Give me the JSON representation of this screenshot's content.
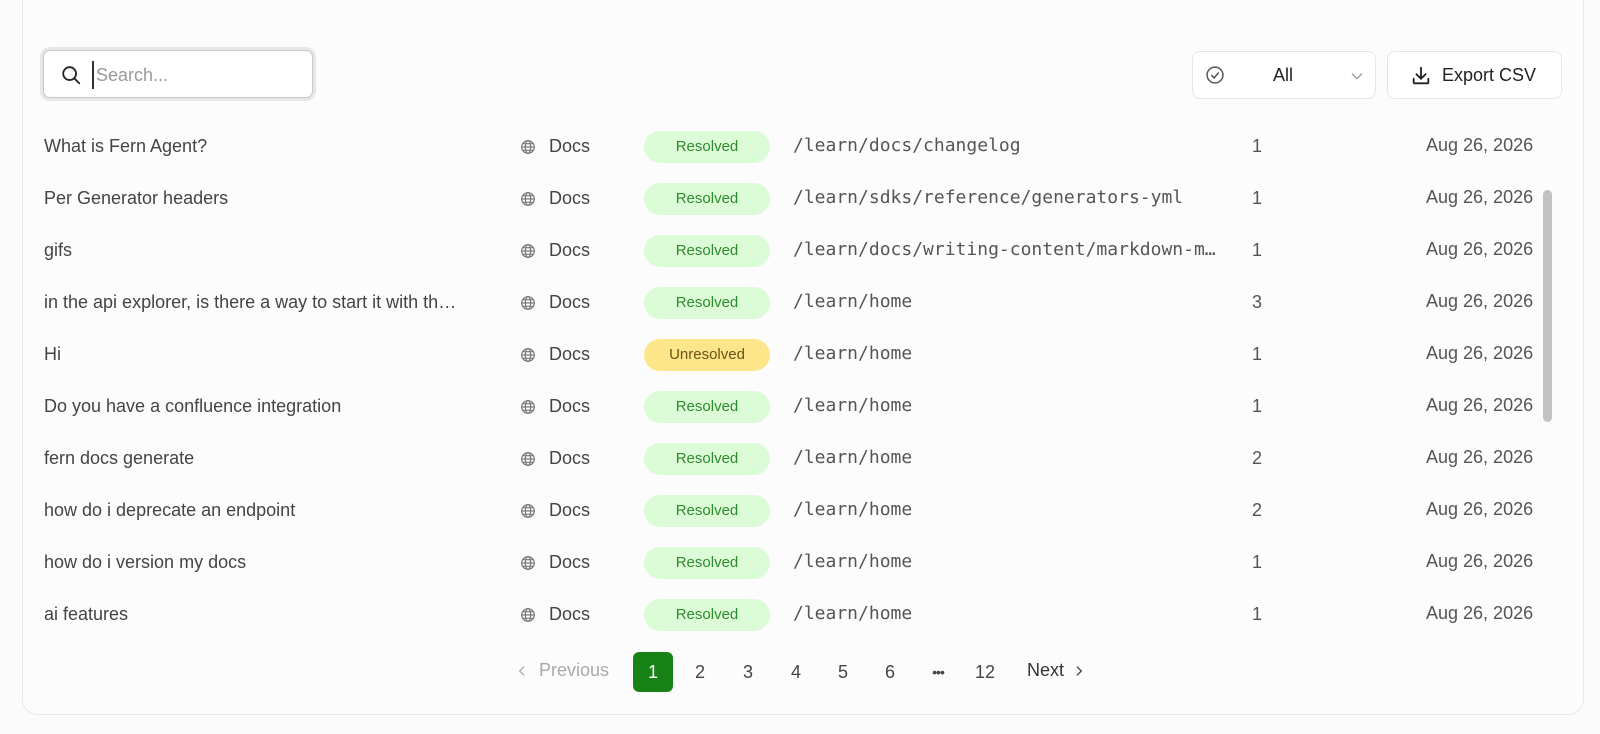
{
  "search": {
    "placeholder": "Search..."
  },
  "filter": {
    "selected": "All"
  },
  "export": {
    "label": "Export CSV"
  },
  "rows": [
    {
      "question": "What is Fern Agent?",
      "source": "Docs",
      "status": "Resolved",
      "path": "/learn/docs/changelog",
      "count": "1",
      "date": "Aug 26, 2026"
    },
    {
      "question": "Per Generator headers",
      "source": "Docs",
      "status": "Resolved",
      "path": "/learn/sdks/reference/generators-yml",
      "count": "1",
      "date": "Aug 26, 2026"
    },
    {
      "question": "gifs",
      "source": "Docs",
      "status": "Resolved",
      "path": "/learn/docs/writing-content/markdown-m…",
      "count": "1",
      "date": "Aug 26, 2026"
    },
    {
      "question": "in the api explorer, is there a way to start it with th…",
      "source": "Docs",
      "status": "Resolved",
      "path": "/learn/home",
      "count": "3",
      "date": "Aug 26, 2026"
    },
    {
      "question": "Hi",
      "source": "Docs",
      "status": "Unresolved",
      "path": "/learn/home",
      "count": "1",
      "date": "Aug 26, 2026"
    },
    {
      "question": "Do you have a confluence integration",
      "source": "Docs",
      "status": "Resolved",
      "path": "/learn/home",
      "count": "1",
      "date": "Aug 26, 2026"
    },
    {
      "question": "fern docs generate",
      "source": "Docs",
      "status": "Resolved",
      "path": "/learn/home",
      "count": "2",
      "date": "Aug 26, 2026"
    },
    {
      "question": "how do i deprecate an endpoint",
      "source": "Docs",
      "status": "Resolved",
      "path": "/learn/home",
      "count": "2",
      "date": "Aug 26, 2026"
    },
    {
      "question": "how do i version my docs",
      "source": "Docs",
      "status": "Resolved",
      "path": "/learn/home",
      "count": "1",
      "date": "Aug 26, 2026"
    },
    {
      "question": "ai features",
      "source": "Docs",
      "status": "Resolved",
      "path": "/learn/home",
      "count": "1",
      "date": "Aug 26, 2026"
    }
  ],
  "pagination": {
    "previous": "Previous",
    "next": "Next",
    "pages": [
      "1",
      "2",
      "3",
      "4",
      "5",
      "6",
      "12"
    ],
    "ellipsis": "•••",
    "current": "1"
  },
  "colors": {
    "accent": "#178317",
    "resolved_bg": "#dcfbd7",
    "unresolved_bg": "#fde68a"
  }
}
